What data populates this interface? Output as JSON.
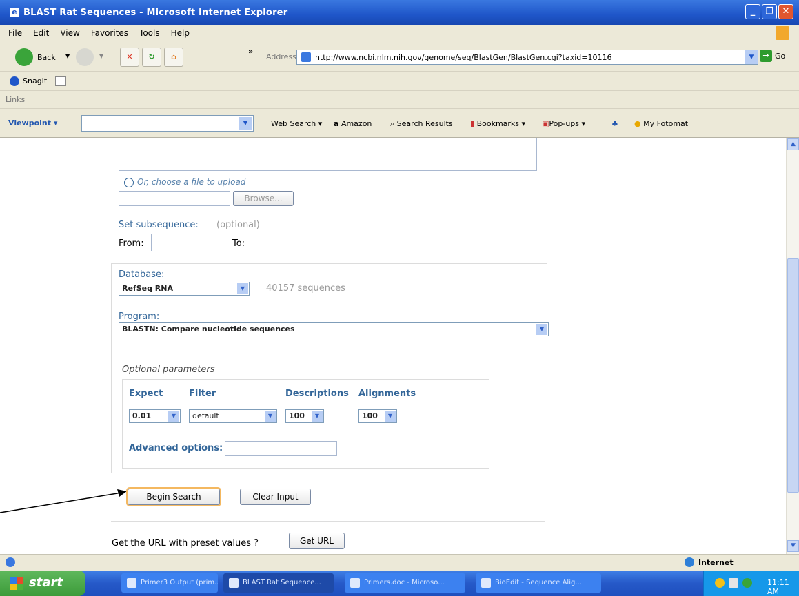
{
  "window": {
    "title": "BLAST Rat Sequences - Microsoft Internet Explorer"
  },
  "menu": [
    "File",
    "Edit",
    "View",
    "Favorites",
    "Tools",
    "Help"
  ],
  "toolbar": {
    "back": "Back",
    "address_label": "Address",
    "url": "http://www.ncbi.nlm.nih.gov/genome/seq/BlastGen/BlastGen.cgi?taxid=10116",
    "go": "Go",
    "chevron": "»"
  },
  "snagit": {
    "label": "SnagIt"
  },
  "links": {
    "label": "Links"
  },
  "viewpoint": {
    "label": "Viewpoint",
    "web_search": "Web Search",
    "amazon": "Amazon",
    "search_results": "Search Results",
    "bookmarks": "Bookmarks",
    "popups": "Pop-ups",
    "fotomat": "My Fotomat"
  },
  "form": {
    "upload_label": "Or, choose a file to upload",
    "browse": "Browse...",
    "subseq_label": "Set subsequence:",
    "optional": "(optional)",
    "from": "From:",
    "to": "To:",
    "database_label": "Database:",
    "database_value": "RefSeq RNA",
    "sequence_count": "40157 sequences",
    "program_label": "Program:",
    "program_value": "BLASTN: Compare nucleotide sequences",
    "optional_params": "Optional parameters",
    "expect_label": "Expect",
    "expect_value": "0.01",
    "filter_label": "Filter",
    "filter_value": "default",
    "descriptions_label": "Descriptions",
    "descriptions_value": "100",
    "alignments_label": "Alignments",
    "alignments_value": "100",
    "advanced_label": "Advanced options:",
    "begin_search": "Begin Search",
    "clear_input": "Clear Input",
    "url_prompt": "Get the URL with preset values ?",
    "get_url": "Get URL"
  },
  "status": {
    "zone": "Internet"
  },
  "taskbar": {
    "start": "start",
    "tasks": [
      "Primer3 Output (prim...",
      "BLAST Rat Sequence...",
      "Primers.doc - Microso...",
      "BioEdit - Sequence Alig..."
    ],
    "clock": "11:11 AM"
  }
}
